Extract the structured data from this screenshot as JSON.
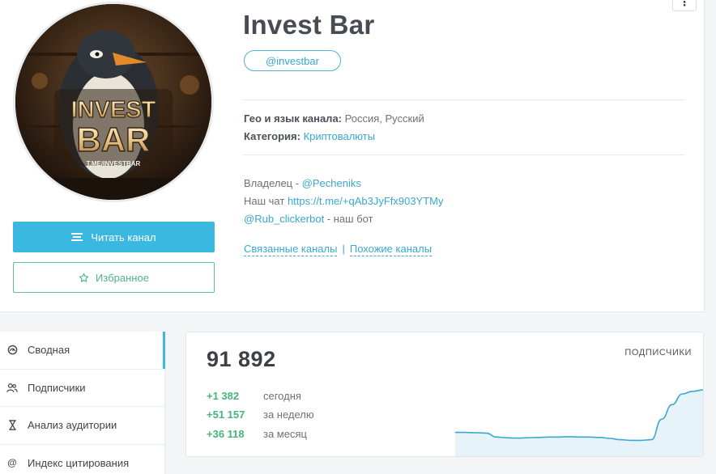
{
  "channel": {
    "title": "Invest Bar",
    "handle": "@investbar",
    "avatar_text_main1": "INVEST",
    "avatar_text_main2": "BAR",
    "avatar_text_small": "T.ME/INVESTBAR"
  },
  "menu": {
    "dots": "⋮"
  },
  "buttons": {
    "read_label": "Читать канал",
    "fav_label": "Избранное"
  },
  "info": {
    "geo_label": "Гео и язык канала:",
    "geo_value": "Россия, Русский",
    "category_label": "Категория:",
    "category_value": "Криптовалюты"
  },
  "description": {
    "line1_prefix": "Владелец - ",
    "line1_link": "@Pecheniks",
    "line2_prefix": "Наш чат ",
    "line2_link": "https://t.me/+qAb3JyFfx903YTMy",
    "line3_link": "@Rub_clickerbot",
    "line3_suffix": " - наш бот"
  },
  "related": {
    "related_label": "Связанные каналы",
    "separator": "|",
    "similar_label": "Похожие каналы"
  },
  "sidebar": {
    "items": [
      {
        "label": "Сводная",
        "icon": "gauge-icon",
        "active": true
      },
      {
        "label": "Подписчики",
        "icon": "users-icon",
        "active": false
      },
      {
        "label": "Анализ аудитории",
        "icon": "hourglass-icon",
        "active": false
      },
      {
        "label": "Индекс цитирования",
        "icon": "at-icon",
        "active": false
      }
    ]
  },
  "stats": {
    "subscribers_total": "91 892",
    "subscribers_label": "подписчики",
    "today_value": "+1 382",
    "today_label": "сегодня",
    "week_value": "+51 157",
    "week_label": "за неделю",
    "month_value": "+36 118",
    "month_label": "за месяц"
  },
  "colors": {
    "accent_blue": "#3bb8e0",
    "accent_green": "#46b47c",
    "spark_line": "#3aa7d0"
  },
  "chart_data": {
    "type": "area",
    "values": [
      20,
      20,
      19.5,
      19,
      13,
      12,
      11.5,
      12,
      12.5,
      13,
      13,
      13.5,
      13,
      13,
      12.5,
      11,
      9,
      8,
      8,
      9,
      40,
      62,
      78,
      82,
      84
    ]
  }
}
